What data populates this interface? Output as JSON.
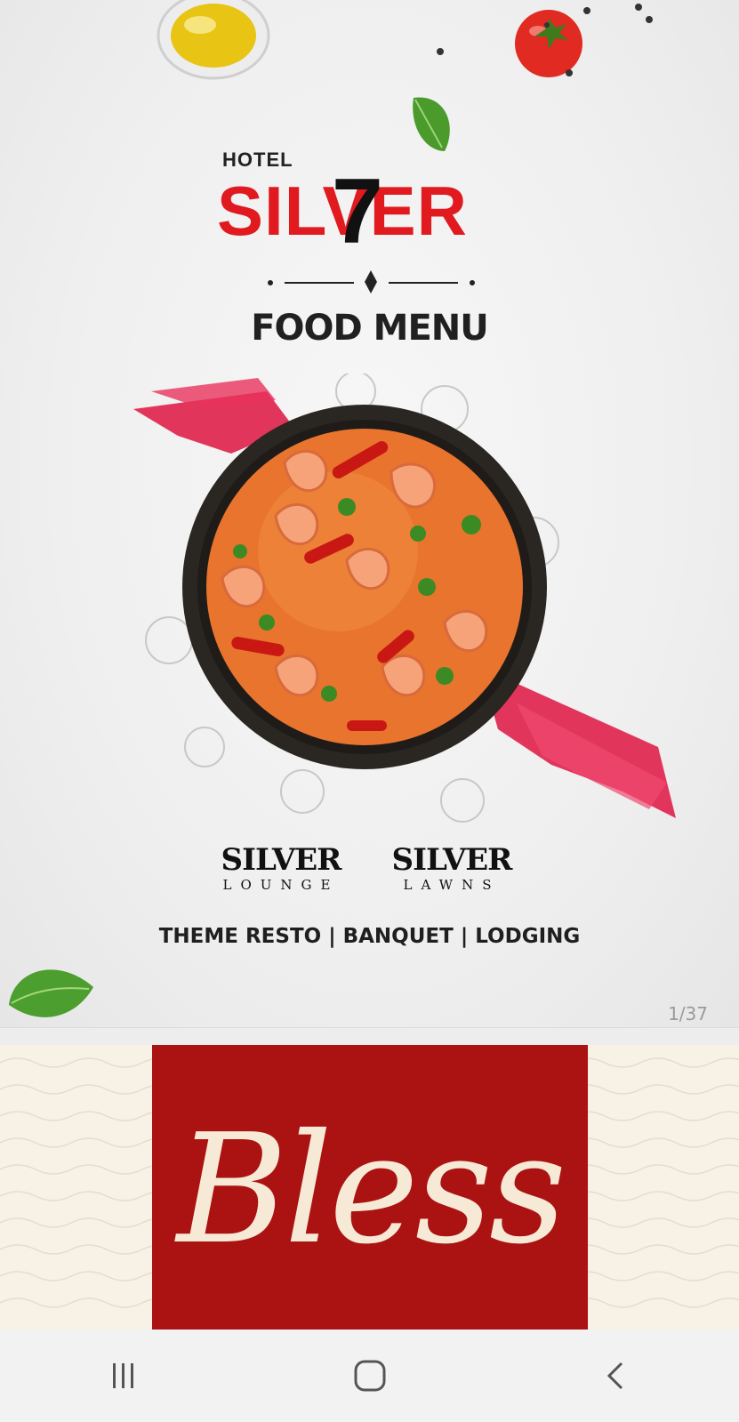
{
  "cover": {
    "logo_prefix": "HOTEL",
    "logo_name": "SILVER",
    "logo_seven": "7",
    "title": "FOOD MENU",
    "sub_logos": [
      {
        "name": "SILVER",
        "sub": "LOUNGE"
      },
      {
        "name": "SILVER",
        "sub": "LAWNS"
      }
    ],
    "tagline": "THEME RESTO | BANQUET | LODGING",
    "page_counter": "1/37"
  },
  "next_page": {
    "heading": "Bless"
  },
  "colors": {
    "brand_red": "#e01a1f",
    "dark_red": "#ab1212",
    "cream": "#f6ead6"
  },
  "navbar": {
    "buttons": [
      "recent-apps-icon",
      "home-icon",
      "back-icon"
    ]
  }
}
